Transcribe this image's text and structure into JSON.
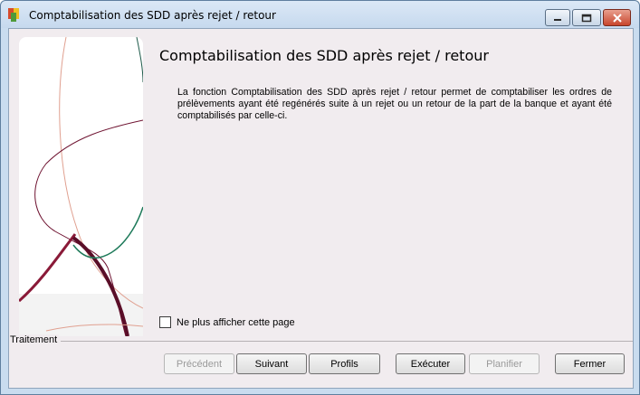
{
  "window": {
    "title": "Comptabilisation des SDD après rejet / retour"
  },
  "page": {
    "heading": "Comptabilisation des SDD après rejet / retour",
    "description": "La fonction Comptabilisation des SDD après rejet / retour permet de comptabiliser les ordres de prélèvements ayant été regénérés suite à un rejet ou un retour de la part de la banque et ayant été comptabilisés par celle-ci.",
    "checkbox_label": "Ne plus afficher cette page",
    "checkbox_checked": false,
    "group_label": "Traitement"
  },
  "buttons": {
    "previous": "Précédent",
    "next": "Suivant",
    "profiles": "Profils",
    "execute": "Exécuter",
    "schedule": "Planifier",
    "close": "Fermer"
  },
  "icons": {
    "app": "wizard-app-icon",
    "minimize": "minimize-icon",
    "maximize": "maximize-icon",
    "close": "close-icon"
  },
  "colors": {
    "curve_dark_red": "#6e1230",
    "curve_green": "#1e7a5a",
    "curve_peach": "#e0a090"
  }
}
